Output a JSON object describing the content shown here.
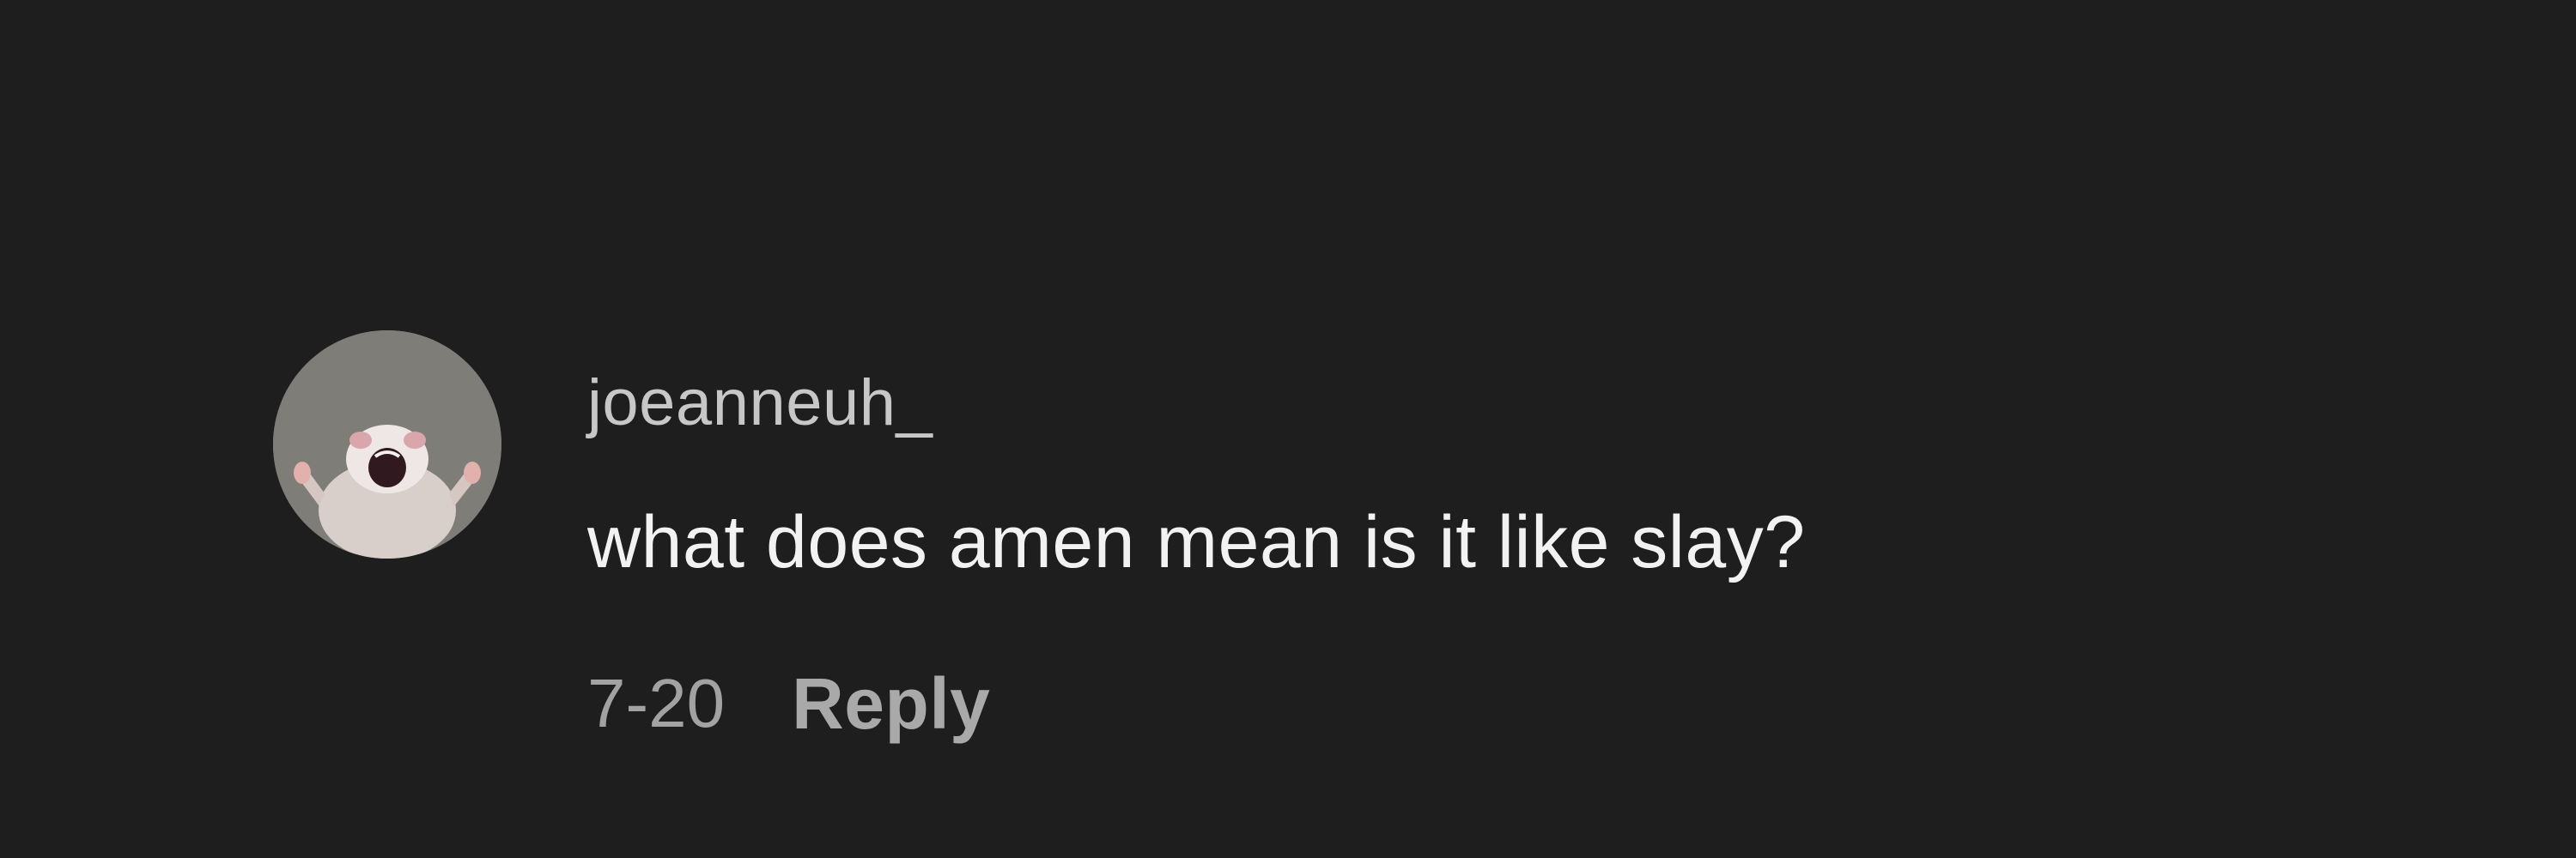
{
  "comment": {
    "avatar_icon": "user-avatar-rat-icon",
    "username": "joeanneuh_",
    "text": "what does amen mean is it like slay?",
    "date": "7-20",
    "reply_label": "Reply"
  },
  "colors": {
    "background": "#1f1e1f",
    "username": "#c7c7c7",
    "text": "#f2f2f2",
    "meta": "#a2a2a2",
    "reply": "#a9a9a9"
  }
}
